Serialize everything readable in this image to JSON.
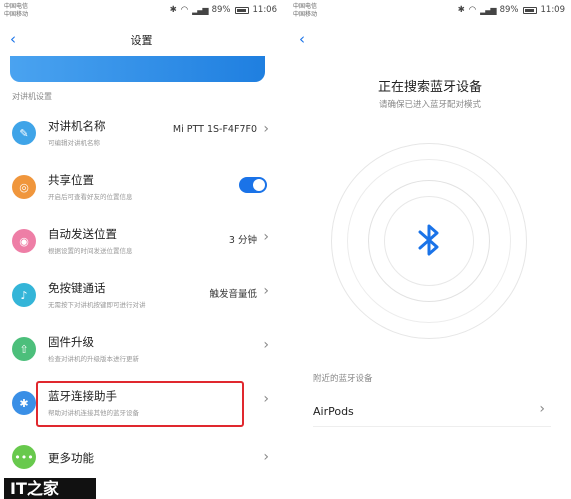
{
  "left": {
    "status": {
      "carrier1": "中国电信",
      "carrier2": "中国移动",
      "battery": "89%",
      "time": "11:06"
    },
    "header": {
      "title": "设置"
    },
    "section_label": "对讲机设置",
    "rows": [
      {
        "title": "对讲机名称",
        "subtitle": "可编辑对讲机名称",
        "value": "Mi PTT 1S-F4F7F0",
        "icon": "pen-icon",
        "color": "#3fa4e8"
      },
      {
        "title": "共享位置",
        "subtitle": "开启后可查看好友的位置信息",
        "value": "",
        "icon": "location-icon",
        "color": "#f0963c"
      },
      {
        "title": "自动发送位置",
        "subtitle": "根据设置的时间发送位置信息",
        "value": "3 分钟",
        "icon": "timer-icon",
        "color": "#ee7ea6"
      },
      {
        "title": "免按键通话",
        "subtitle": "无需按下对讲机按键即可进行对讲",
        "value": "触发音量低",
        "icon": "mic-icon",
        "color": "#34b5d8"
      },
      {
        "title": "固件升级",
        "subtitle": "检查对讲机的升级版本进行更新",
        "value": "",
        "icon": "upgrade-icon",
        "color": "#4cbf7b"
      },
      {
        "title": "蓝牙连接助手",
        "subtitle": "帮助对讲机连接其他的蓝牙设备",
        "value": "",
        "icon": "bluetooth-icon",
        "color": "#3a8fe6"
      },
      {
        "title": "更多功能",
        "subtitle": "",
        "value": "",
        "icon": "more-icon",
        "color": "#68c94d"
      }
    ],
    "logo": "IT之家"
  },
  "right": {
    "status": {
      "carrier1": "中国电信",
      "carrier2": "中国移动",
      "battery": "89%",
      "time": "11:09"
    },
    "title": "正在搜索蓝牙设备",
    "subtitle": "请确保已进入蓝牙配对模式",
    "near_label": "附近的蓝牙设备",
    "device": "AirPods"
  },
  "colors": {
    "accent": "#1a73e8",
    "highlight": "#e0282e",
    "bluetooth": "#1a73e8"
  }
}
